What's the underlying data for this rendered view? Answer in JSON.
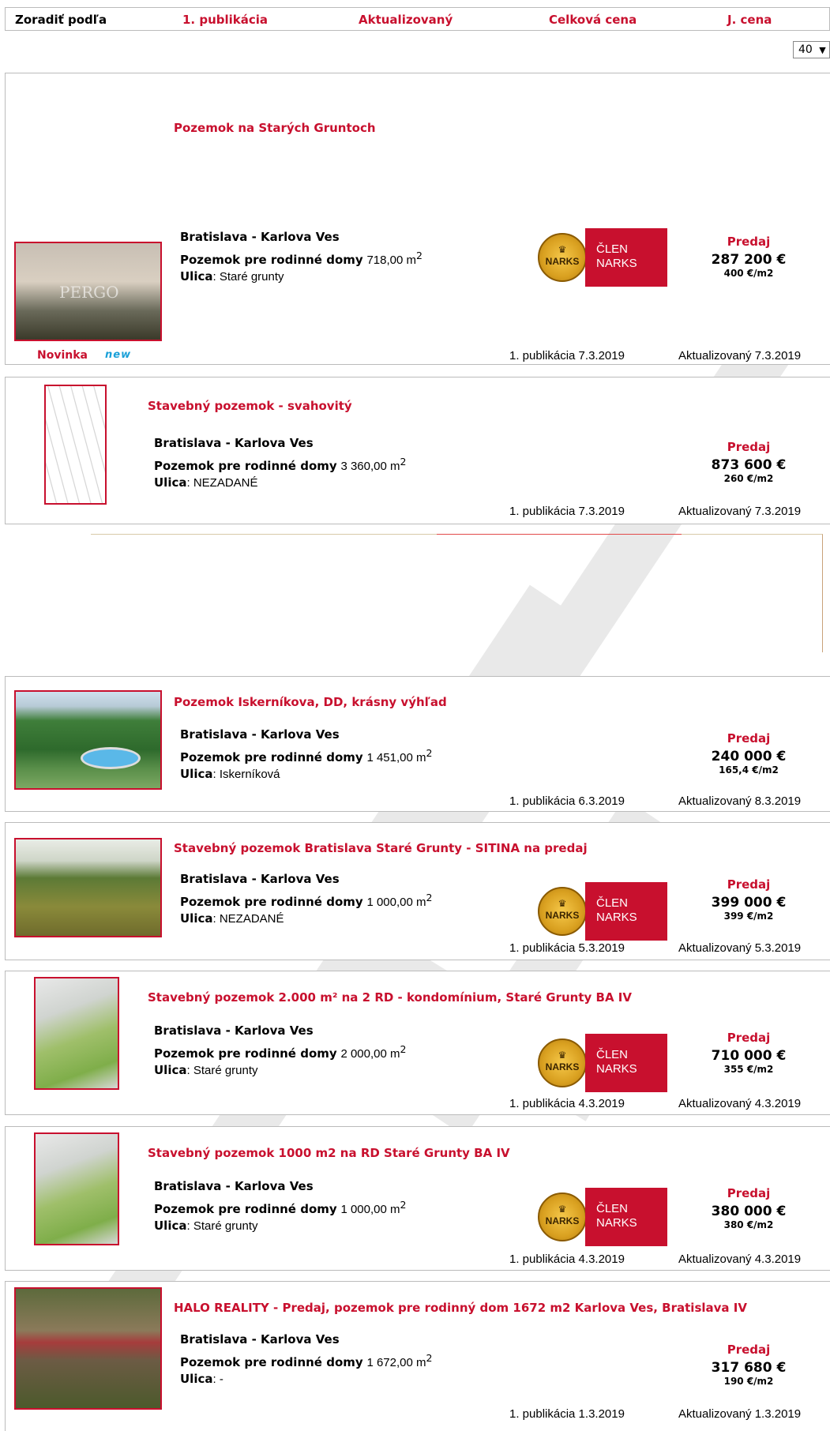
{
  "sort_bar": {
    "label": "Zoradiť podľa",
    "options": [
      "1. publikácia",
      "Aktualizovaný",
      "Celková cena",
      "J. cena"
    ]
  },
  "per_page": {
    "value": "40",
    "arrow": "▼"
  },
  "narks": {
    "line1": "ČLEN",
    "line2": "NARKS",
    "seal": "NARKS"
  },
  "listings": [
    {
      "title": "Pozemok na Starých Gruntoch",
      "location": "Bratislava - Karlova Ves",
      "type_label": "Pozemok pre rodinné domy",
      "area": "718,00 m",
      "street_label": "Ulica",
      "street": ": Staré grunty",
      "deal": "Predaj",
      "price": "287 200 €",
      "unit_price": "400 €/m2",
      "published": "1. publikácia 7.3.2019",
      "updated": "Aktualizovaný 7.3.2019",
      "novinka": "Novinka",
      "new_badge": "new",
      "thumb_text": "PERGO"
    },
    {
      "title": "Stavebný pozemok - svahovitý",
      "location": "Bratislava - Karlova Ves",
      "type_label": "Pozemok pre rodinné domy",
      "area": "3 360,00 m",
      "street_label": "Ulica",
      "street": ": NEZADANÉ",
      "deal": "Predaj",
      "price": "873 600 €",
      "unit_price": "260 €/m2",
      "published": "1. publikácia 7.3.2019",
      "updated": "Aktualizovaný 7.3.2019"
    },
    {
      "title": "Pozemok Iskerníkova, DD, krásny výhľad",
      "location": "Bratislava - Karlova Ves",
      "type_label": "Pozemok pre rodinné domy",
      "area": "1 451,00 m",
      "street_label": "Ulica",
      "street": ": Iskerníková",
      "deal": "Predaj",
      "price": "240 000 €",
      "unit_price": "165,4 €/m2",
      "published": "1. publikácia 6.3.2019",
      "updated": "Aktualizovaný 8.3.2019"
    },
    {
      "title": "Stavebný pozemok Bratislava Staré Grunty - SITINA na predaj",
      "location": "Bratislava - Karlova Ves",
      "type_label": "Pozemok pre rodinné domy",
      "area": "1 000,00 m",
      "street_label": "Ulica",
      "street": ": NEZADANÉ",
      "deal": "Predaj",
      "price": "399 000 €",
      "unit_price": "399 €/m2",
      "published": "1. publikácia 5.3.2019",
      "updated": "Aktualizovaný 5.3.2019"
    },
    {
      "title": "Stavebný pozemok 2.000 m² na 2 RD - kondomínium, Staré Grunty BA IV",
      "location": "Bratislava - Karlova Ves",
      "type_label": "Pozemok pre rodinné domy",
      "area": "2 000,00 m",
      "street_label": "Ulica",
      "street": ": Staré grunty",
      "deal": "Predaj",
      "price": "710 000 €",
      "unit_price": "355 €/m2",
      "published": "1. publikácia 4.3.2019",
      "updated": "Aktualizovaný 4.3.2019"
    },
    {
      "title": "Stavebný pozemok 1000 m2 na RD Staré Grunty BA IV",
      "location": "Bratislava - Karlova Ves",
      "type_label": "Pozemok pre rodinné domy",
      "area": "1 000,00 m",
      "street_label": "Ulica",
      "street": ": Staré grunty",
      "deal": "Predaj",
      "price": "380 000 €",
      "unit_price": "380 €/m2",
      "published": "1. publikácia 4.3.2019",
      "updated": "Aktualizovaný 4.3.2019"
    },
    {
      "title": "HALO REALITY - Predaj, pozemok pre rodinný dom 1672 m2 Karlova Ves, Bratislava IV",
      "location": "Bratislava - Karlova Ves",
      "type_label": "Pozemok pre rodinné domy",
      "area": "1 672,00 m",
      "street_label": "Ulica",
      "street": ": -",
      "deal": "Predaj",
      "price": "317 680 €",
      "unit_price": "190 €/m2",
      "published": "1. publikácia 1.3.2019",
      "updated": "Aktualizovaný 1.3.2019"
    }
  ]
}
